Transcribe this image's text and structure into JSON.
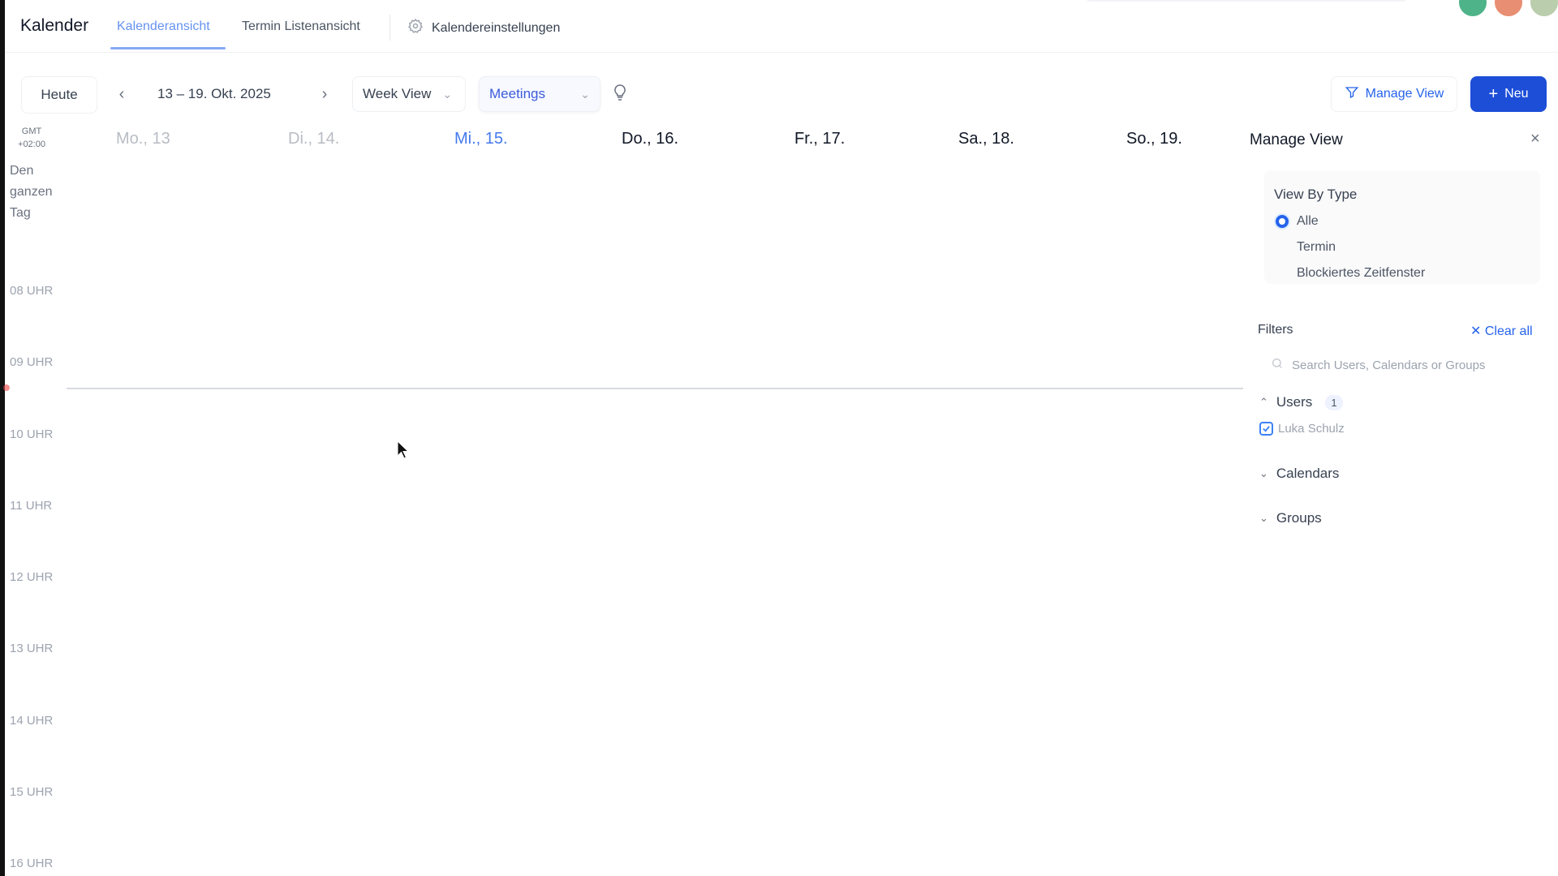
{
  "app": {
    "title": "Kalender"
  },
  "tabs": [
    {
      "label": "Kalenderansicht"
    },
    {
      "label": "Termin Listenansicht"
    },
    {
      "label": "Kalendereinstellungen"
    }
  ],
  "toolbar": {
    "today_label": "Heute",
    "date_range": "13 – 19. Okt. 2025",
    "view_select": "Week View",
    "type_select": "Meetings",
    "manage_view_label": "Manage View",
    "new_label": "Neu"
  },
  "calendar": {
    "timezone_line1": "GMT",
    "timezone_line2": "+02:00",
    "allday_lines": [
      "Den",
      "ganzen",
      "Tag"
    ],
    "days": [
      {
        "label": "Mo., 13",
        "state": "past"
      },
      {
        "label": "Di., 14.",
        "state": "past"
      },
      {
        "label": "Mi., 15.",
        "state": "today"
      },
      {
        "label": "Do., 16.",
        "state": "future"
      },
      {
        "label": "Fr., 17.",
        "state": "future"
      },
      {
        "label": "Sa., 18.",
        "state": "future"
      },
      {
        "label": "So., 19.",
        "state": "future"
      }
    ],
    "hours": [
      "08 UHR",
      "09 UHR",
      "10 UHR",
      "11 UHR",
      "12 UHR",
      "13 UHR",
      "14 UHR",
      "15 UHR",
      "16 UHR"
    ]
  },
  "manage_panel": {
    "title": "Manage View",
    "view_by_type_label": "View By Type",
    "options": [
      {
        "label": "Alle",
        "checked": true
      },
      {
        "label": "Termin",
        "checked": false
      },
      {
        "label": "Blockiertes Zeitfenster",
        "checked": false
      }
    ],
    "filters_label": "Filters",
    "clear_all_label": "Clear all",
    "search_placeholder": "Search Users, Calendars or Groups",
    "users_label": "Users",
    "users_count": "1",
    "user_name": "Luka Schulz",
    "calendars_label": "Calendars",
    "groups_label": "Groups"
  },
  "colors": {
    "accent": "#2563eb",
    "new_button": "#1d4ed8"
  }
}
